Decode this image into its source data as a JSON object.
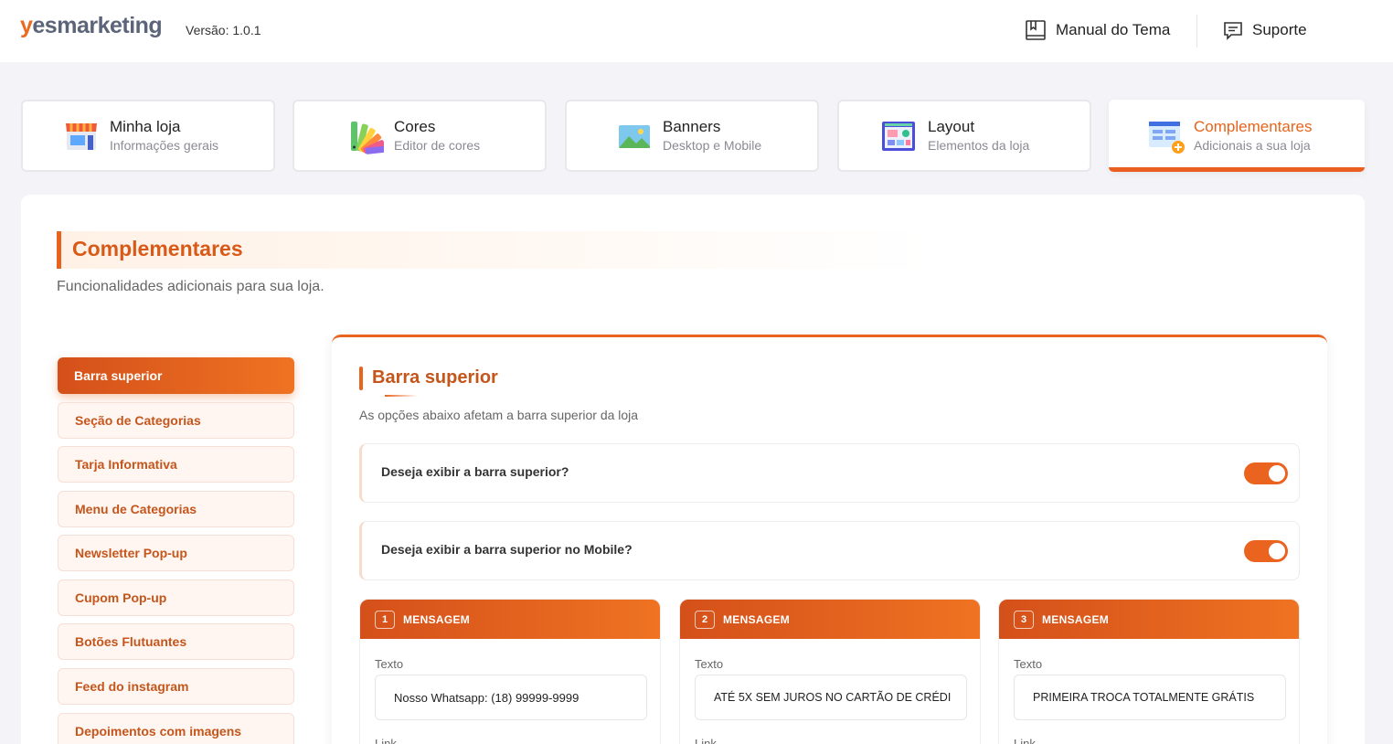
{
  "header": {
    "logo_y": "y",
    "logo_rest": "esmarketing",
    "version": "Versão: 1.0.1",
    "manual_label": "Manual do Tema",
    "support_label": "Suporte"
  },
  "tabs": [
    {
      "title": "Minha loja",
      "subtitle": "Informações gerais",
      "icon": "store-icon"
    },
    {
      "title": "Cores",
      "subtitle": "Editor de cores",
      "icon": "color-palette-icon"
    },
    {
      "title": "Banners",
      "subtitle": "Desktop e Mobile",
      "icon": "image-icon"
    },
    {
      "title": "Layout",
      "subtitle": "Elementos da loja",
      "icon": "layout-icon"
    },
    {
      "title": "Complementares",
      "subtitle": "Adicionais a sua loja",
      "icon": "addons-icon",
      "active": true
    }
  ],
  "page": {
    "title": "Complementares",
    "subtitle": "Funcionalidades adicionais para sua loja."
  },
  "sidebar": {
    "items": [
      {
        "label": "Barra superior",
        "active": true
      },
      {
        "label": "Seção de Categorias"
      },
      {
        "label": "Tarja Informativa"
      },
      {
        "label": "Menu de Categorias"
      },
      {
        "label": "Newsletter Pop-up"
      },
      {
        "label": "Cupom Pop-up"
      },
      {
        "label": "Botões Flutuantes"
      },
      {
        "label": "Feed do instagram"
      },
      {
        "label": "Depoimentos com imagens"
      }
    ]
  },
  "section": {
    "title": "Barra superior",
    "subtitle": "As opções abaixo afetam a barra superior da loja",
    "options": [
      {
        "label": "Deseja exibir a barra superior?",
        "enabled": true
      },
      {
        "label": "Deseja exibir a barra superior no Mobile?",
        "enabled": true
      }
    ],
    "messages": [
      {
        "number": "1",
        "title": "MENSAGEM",
        "text_label": "Texto",
        "text_value": "Nosso Whatsapp: (18) 99999-9999",
        "link_label": "Link"
      },
      {
        "number": "2",
        "title": "MENSAGEM",
        "text_label": "Texto",
        "text_value": "ATÉ 5X SEM JUROS NO CARTÃO DE CRÉDI",
        "link_label": "Link"
      },
      {
        "number": "3",
        "title": "MENSAGEM",
        "text_label": "Texto",
        "text_value": "PRIMEIRA TROCA TOTALMENTE GRÁTIS",
        "link_label": "Link"
      }
    ]
  },
  "colors": {
    "accent": "#e8641c",
    "accent_dark": "#d4501a",
    "background": "#f4f4f8"
  }
}
